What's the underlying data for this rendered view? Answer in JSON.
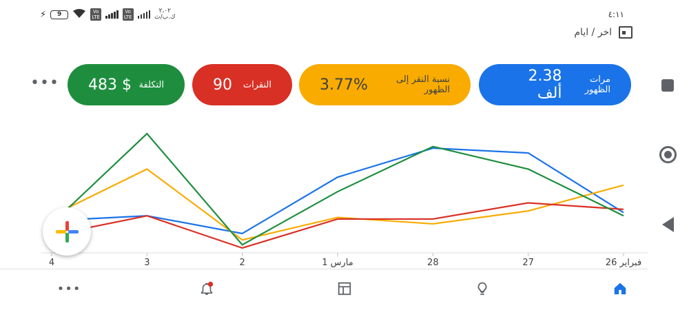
{
  "status_bar": {
    "time": "٤:١١",
    "data_speed_value": "٢،٠٢",
    "data_speed_unit": "ك.ب/ث",
    "battery_level": "9",
    "lte_badge_1": "Vo LTE",
    "lte_badge_2": "Vo LTE"
  },
  "date_range": {
    "label": "اخر / ايام"
  },
  "metrics": [
    {
      "label": "مرات الظهور",
      "value": "2.38 ألف",
      "color": "#1a73e8"
    },
    {
      "label": "نسبة النقر إلى الظهور",
      "value": "3.77%",
      "color": "#f9ab00"
    },
    {
      "label": "النقرات",
      "value": "90",
      "color": "#d93025"
    },
    {
      "label": "التكلفة",
      "value": "$ 483",
      "color": "#1e8e3e"
    }
  ],
  "more_menu_label": "•••",
  "chart_data": {
    "type": "line",
    "categories": [
      "فبراير 26",
      "27",
      "28",
      "مارس 1",
      "2",
      "3",
      "4"
    ],
    "x_direction": "right-to-left",
    "grid": false,
    "legend": "none",
    "series": [
      {
        "color": "#1a73e8",
        "values": [
          25,
          62,
          65,
          47,
          12,
          23,
          20
        ]
      },
      {
        "color": "#f9ab00",
        "values": [
          42,
          26,
          18,
          22,
          8,
          52,
          23
        ]
      },
      {
        "color": "#d93025",
        "values": [
          27,
          31,
          21,
          21,
          3,
          23,
          11
        ]
      },
      {
        "color": "#1e8e3e",
        "values": [
          23,
          52,
          66,
          38,
          5,
          74,
          18
        ]
      }
    ],
    "ylim": [
      0,
      80
    ]
  },
  "bottom_nav": {
    "more_label": "•••"
  },
  "icons": {
    "fab": "add-icon",
    "bell": "notifications-icon",
    "table": "table-icon",
    "bulb": "lightbulb-icon",
    "home": "home-icon"
  }
}
